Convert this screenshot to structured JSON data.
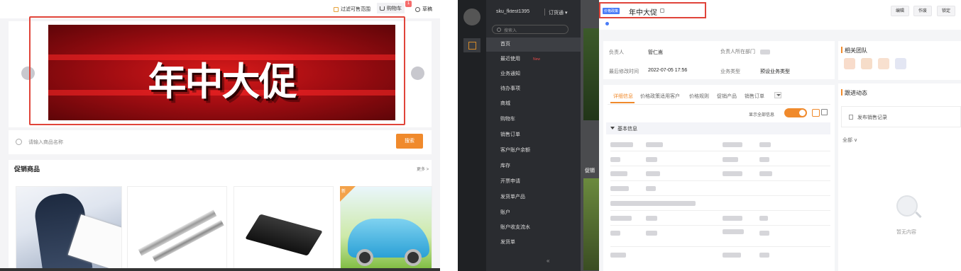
{
  "left": {
    "topbar": {
      "filter_label": "过滤可售范围",
      "cart_label": "购物车",
      "cart_badge": "1",
      "draft_label": "草稿"
    },
    "banner": {
      "title": "年中大促"
    },
    "search": {
      "placeholder": "请输入商品名称",
      "button": "搜索"
    },
    "promo": {
      "title": "促销商品",
      "more": "更多 >",
      "new_tag": "新"
    }
  },
  "right": {
    "sidebar": {
      "username": "sku_fktest1395",
      "edition": "订货通 ▾",
      "search_placeholder": "搜索入",
      "items": [
        {
          "label": "首页"
        },
        {
          "label": "最近使用",
          "tag": "New"
        },
        {
          "label": "业务通知"
        },
        {
          "label": "待办事项"
        },
        {
          "label": "商城"
        },
        {
          "label": "购物车"
        },
        {
          "label": "销售订单"
        },
        {
          "label": "客户账户余额"
        },
        {
          "label": "库存"
        },
        {
          "label": "开票申请"
        },
        {
          "label": "发货单产品"
        },
        {
          "label": "账户"
        },
        {
          "label": "账户收支流水"
        },
        {
          "label": "发货单"
        }
      ],
      "collapse": "«"
    },
    "background_label": "促销",
    "detail": {
      "tag": "价格政策",
      "title": "年中大促",
      "buttons": [
        "编辑",
        "作废",
        "锁定"
      ],
      "info": {
        "owner_label": "负责人",
        "owner_value": "管仁嵩",
        "dept_label": "负责人所在部门",
        "modified_label": "最后修改时间",
        "modified_value": "2022-07-05 17:56",
        "biztype_label": "业务类型",
        "biztype_value": "预设业务类型"
      },
      "tabs": [
        "详细信息",
        "价格政策适用客户",
        "价格规则",
        "促销产品",
        "销售订单"
      ],
      "show_all": "显示全部信息",
      "section": "基本信息"
    },
    "related": {
      "team_title": "相关团队",
      "activity_title": "跟进动态",
      "publish": "发布销售记录",
      "filter": "全部 ∨",
      "empty": "暂无内容"
    }
  }
}
